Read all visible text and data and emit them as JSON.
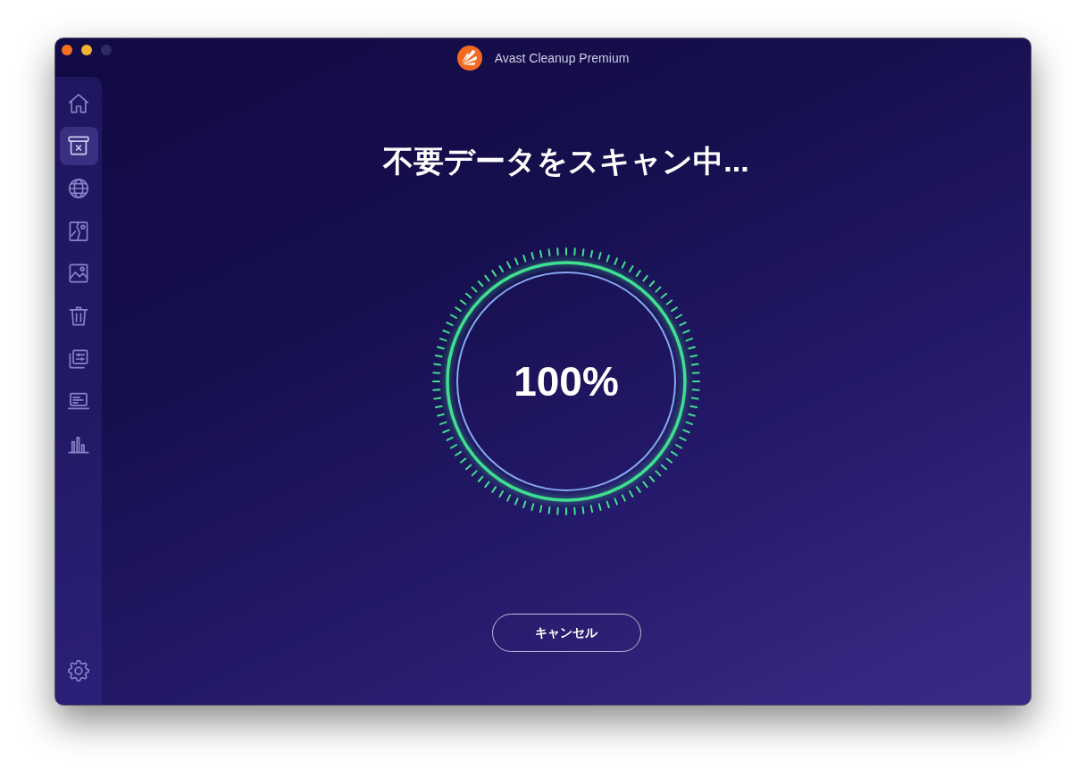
{
  "window": {
    "title": "Avast Cleanup Premium"
  },
  "sidebar": {
    "items": [
      {
        "kind": "house",
        "selected": false
      },
      {
        "kind": "bin",
        "selected": true
      },
      {
        "kind": "globe",
        "selected": false
      },
      {
        "kind": "split",
        "selected": false
      },
      {
        "kind": "picture",
        "selected": false
      },
      {
        "kind": "trash",
        "selected": false
      },
      {
        "kind": "layers",
        "selected": false
      },
      {
        "kind": "laptop",
        "selected": false
      },
      {
        "kind": "bars",
        "selected": false
      }
    ]
  },
  "scan": {
    "heading": "不要データをスキャン中...",
    "percent": "100%",
    "level": 1
  },
  "buttons": [
    "キャンセル"
  ]
}
